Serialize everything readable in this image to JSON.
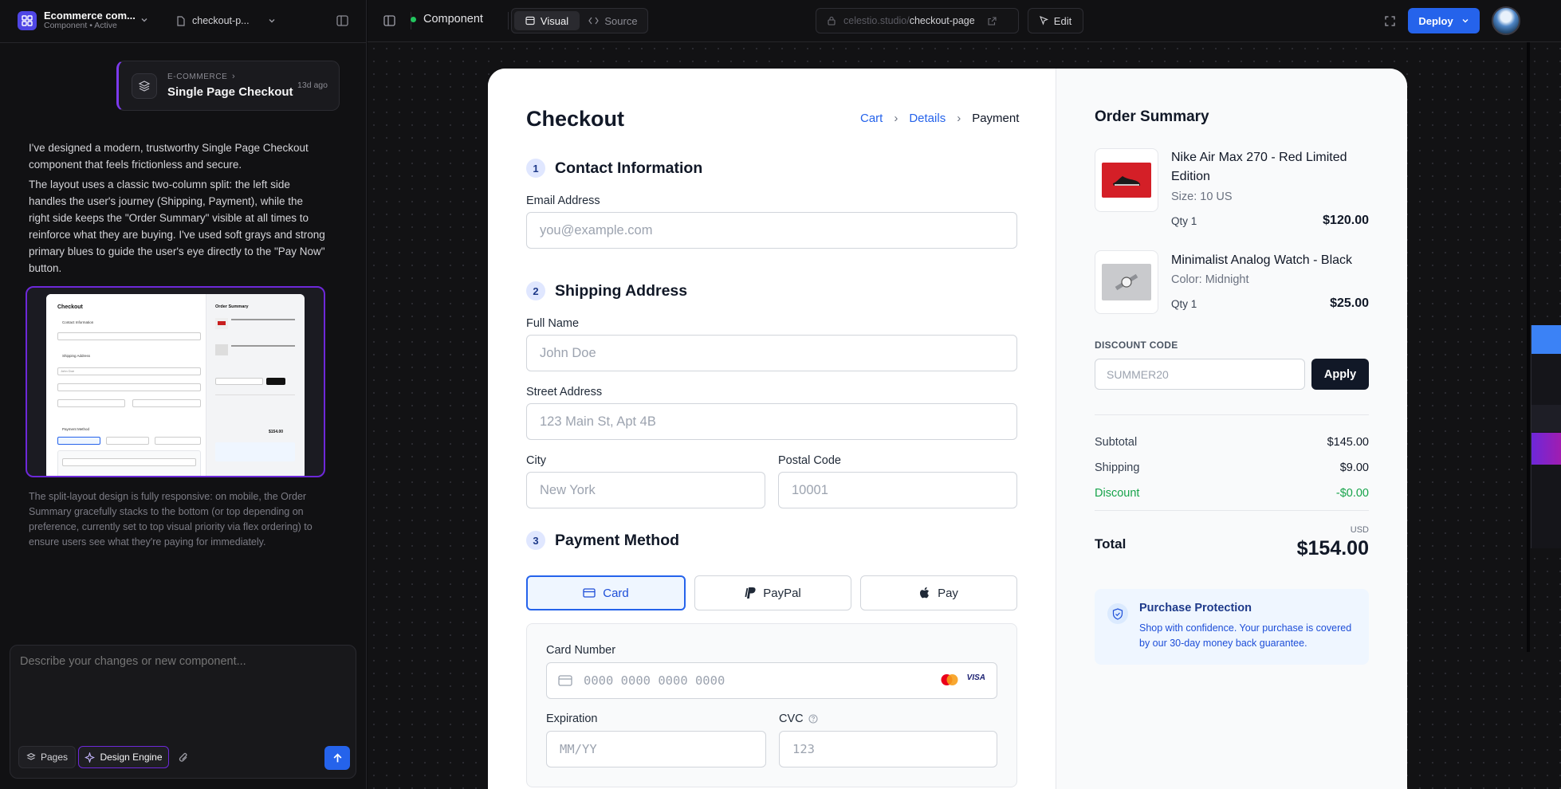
{
  "project": {
    "name": "Ecommerce com...",
    "subtitle": "Component • Active",
    "page_select": "checkout-p..."
  },
  "history_card": {
    "category": "E-COMMERCE",
    "title": "Single Page Checkout",
    "time": "13d ago"
  },
  "chat": {
    "para1": "I've designed a modern, trustworthy Single Page Checkout component that feels frictionless and secure.",
    "para2": "The layout uses a classic two-column split: the left side handles the user's journey (Shipping, Payment), while the right side keeps the \"Order Summary\" visible at all times to reinforce what they are buying. I've used soft grays and strong primary blues to guide the user's eye directly to the \"Pay Now\" button.",
    "note": "The split-layout design is fully responsive: on mobile, the Order Summary gracefully stacks to the bottom (or top depending on preference, currently set to top visual priority via flex ordering) to ensure users see what they're paying for immediately.",
    "input_placeholder": "Describe your changes or new component...",
    "pages_label": "Pages",
    "engine_label": "Design Engine"
  },
  "topbar": {
    "component_label": "Component",
    "tab_visual": "Visual",
    "tab_source": "Source",
    "url_prefix": "celestio.studio/",
    "url_path": "checkout-page",
    "edit_label": "Edit",
    "deploy_label": "Deploy"
  },
  "checkout": {
    "title": "Checkout",
    "breadcrumb": [
      "Cart",
      "Details",
      "Payment"
    ],
    "contact": {
      "num": "1",
      "title": "Contact Information",
      "email_label": "Email Address",
      "email_ph": "you@example.com"
    },
    "shipping": {
      "num": "2",
      "title": "Shipping Address",
      "name_label": "Full Name",
      "name_ph": "John Doe",
      "street_label": "Street Address",
      "street_ph": "123 Main St, Apt 4B",
      "city_label": "City",
      "city_ph": "New York",
      "zip_label": "Postal Code",
      "zip_ph": "10001"
    },
    "payment": {
      "num": "3",
      "title": "Payment Method",
      "methods": [
        "Card",
        "PayPal",
        "Pay"
      ],
      "card_label": "Card Number",
      "card_ph": "0000 0000 0000 0000",
      "visa": "VISA",
      "exp_label": "Expiration",
      "exp_ph": "MM/YY",
      "cvc_label": "CVC",
      "cvc_ph": "123"
    }
  },
  "summary": {
    "title": "Order Summary",
    "items": [
      {
        "name": "Nike Air Max 270 - Red Limited Edition",
        "variant": "Size: 10 US",
        "qty": "Qty 1",
        "price": "$120.00"
      },
      {
        "name": "Minimalist Analog Watch - Black",
        "variant": "Color: Midnight",
        "qty": "Qty 1",
        "price": "$25.00"
      }
    ],
    "discount_label": "DISCOUNT CODE",
    "discount_ph": "SUMMER20",
    "apply": "Apply",
    "subtotal_label": "Subtotal",
    "subtotal": "$145.00",
    "shipping_label": "Shipping",
    "shipping": "$9.00",
    "discount_row_label": "Discount",
    "discount": "-$0.00",
    "total_label": "Total",
    "currency": "USD",
    "total": "$154.00",
    "protection_title": "Purchase Protection",
    "protection_text": "Shop with confidence. Your purchase is covered by our 30-day money back guarantee."
  },
  "thumb": {
    "checkout_title": "Checkout",
    "order_summary": "Order Summary",
    "contact": "Contact Information",
    "shipping": "Shipping Address",
    "payment": "Payment Method",
    "john": "John Doe",
    "total": "$154.00"
  },
  "colors": {
    "accent": "#2563eb",
    "status": "#22c55e",
    "purple": "#7c3aed"
  }
}
